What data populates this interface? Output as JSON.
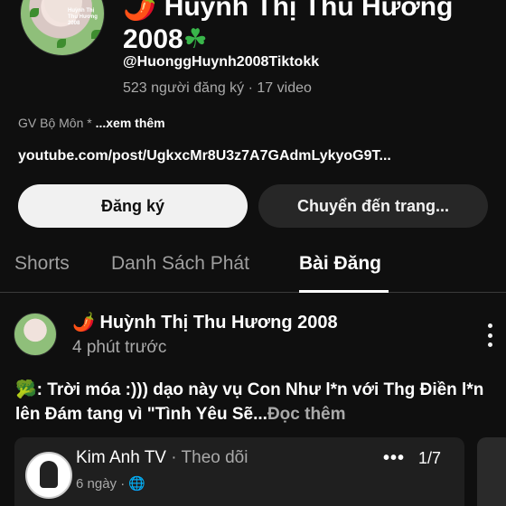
{
  "channel": {
    "title_line1": "🌶️ Huỳnh Thị Thu Hương",
    "title_line2": "2008",
    "handle": "@HuonggHuynh2008Tiktokk",
    "stats": "523 người đăng ký · 17 video",
    "description": "GV Bộ Môn * ",
    "description_more": "...xem thêm",
    "link": "youtube.com/post/UgkxcMr8U3z7A7GAdmLykyoG9T..."
  },
  "actions": {
    "subscribe": "Đăng ký",
    "go_to_channel": "Chuyển đến trang..."
  },
  "tabs": [
    {
      "label": "Shorts",
      "active": false
    },
    {
      "label": "Danh Sách Phát",
      "active": false
    },
    {
      "label": "Bài Đăng",
      "active": true
    }
  ],
  "post": {
    "author": "🌶️ Huỳnh Thị Thu Hương 2008",
    "time": "4 phút trước",
    "text": "🥦: Trời móa :))) dạo này vụ Con Như l*n với Thg Điền l*n lên Đám tang vì \"Tình Yêu Sẽ...",
    "read_more": "Đọc thêm",
    "shared_card": {
      "name": "Kim Anh TV",
      "follow": " · Theo dõi",
      "date": "6 ngày · 🌐",
      "pager": "1/7"
    }
  },
  "avatar_caption": "Huỳnh Thị Thu Hương 2008"
}
